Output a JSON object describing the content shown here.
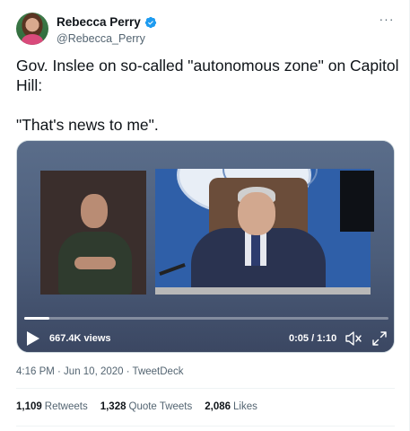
{
  "author": {
    "display_name": "Rebecca Perry",
    "handle": "@Rebecca_Perry",
    "verified": true,
    "avatar_icon": "avatar-photo",
    "verified_icon": "verified-badge-icon"
  },
  "more_menu": {
    "label": "···",
    "icon": "more-options-icon"
  },
  "tweet": {
    "text": "Gov. Inslee on so-called \"autonomous zone\" on Capitol Hill:\n\n\"That's news to me\"."
  },
  "video": {
    "views": "667.4K views",
    "time": "0:05 / 1:10",
    "progress": 0.07,
    "play_icon": "play-icon",
    "mute_icon": "muted-speaker-icon",
    "fullscreen_icon": "fullscreen-icon"
  },
  "meta": {
    "timestamp": "4:16 PM · Jun 10, 2020 · TweetDeck"
  },
  "stats": {
    "retweets_count": "1,109",
    "retweets_label": "Retweets",
    "quotes_count": "1,328",
    "quotes_label": "Quote Tweets",
    "likes_count": "2,086",
    "likes_label": "Likes"
  },
  "colors": {
    "verified_blue": "#1d9bf0",
    "secondary_text": "#536471",
    "primary_text": "#0f1419"
  }
}
